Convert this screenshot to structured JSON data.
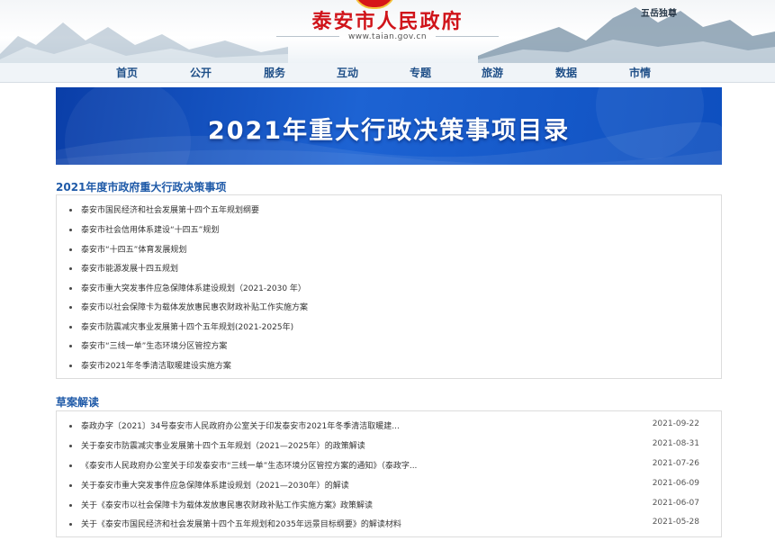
{
  "header": {
    "title": "泰安市人民政府",
    "url": "www.taian.gov.cn",
    "seal_text": "五岳独尊"
  },
  "nav": {
    "items": [
      "首页",
      "公开",
      "服务",
      "互动",
      "专题",
      "旅游",
      "数据",
      "市情"
    ]
  },
  "banner": {
    "title": "2021年重大行政决策事项目录"
  },
  "section1": {
    "title": "2021年度市政府重大行政决策事项",
    "items": [
      "泰安市国民经济和社会发展第十四个五年规划纲要",
      "泰安市社会信用体系建设“十四五”规划",
      "泰安市“十四五”体育发展规划",
      "泰安市能源发展十四五规划",
      "泰安市重大突发事件应急保障体系建设规划（2021-2030 年）",
      "泰安市以社会保障卡为载体发放惠民惠农财政补贴工作实施方案",
      "泰安市防震减灾事业发展第十四个五年规划(2021-2025年)",
      "泰安市“三线一单”生态环境分区管控方案",
      "泰安市2021年冬季清洁取暖建设实施方案"
    ]
  },
  "section2": {
    "title": "草案解读",
    "items": [
      {
        "text": "泰政办字〔2021〕34号泰安市人民政府办公室关于印发泰安市2021年冬季清洁取暖建...",
        "date": "2021-09-22"
      },
      {
        "text": "关于泰安市防震减灾事业发展第十四个五年规划（2021—2025年）的政策解读",
        "date": "2021-08-31"
      },
      {
        "text": "《泰安市人民政府办公室关于印发泰安市“三线一单”生态环境分区管控方案的通知》（泰政字...",
        "date": "2021-07-26"
      },
      {
        "text": "关于泰安市重大突发事件应急保障体系建设规划（2021—2030年）的解读",
        "date": "2021-06-09"
      },
      {
        "text": "关于《泰安市以社会保障卡为载体发放惠民惠农财政补贴工作实施方案》政策解读",
        "date": "2021-06-07"
      },
      {
        "text": "关于《泰安市国民经济和社会发展第十四个五年规划和2035年远景目标纲要》的解读材料",
        "date": "2021-05-28"
      }
    ]
  },
  "colors": {
    "title_red": "#d0141a",
    "nav_blue": "#1f4f88",
    "section_blue": "#1f5aa8",
    "banner_blue": "#1d63d3"
  }
}
